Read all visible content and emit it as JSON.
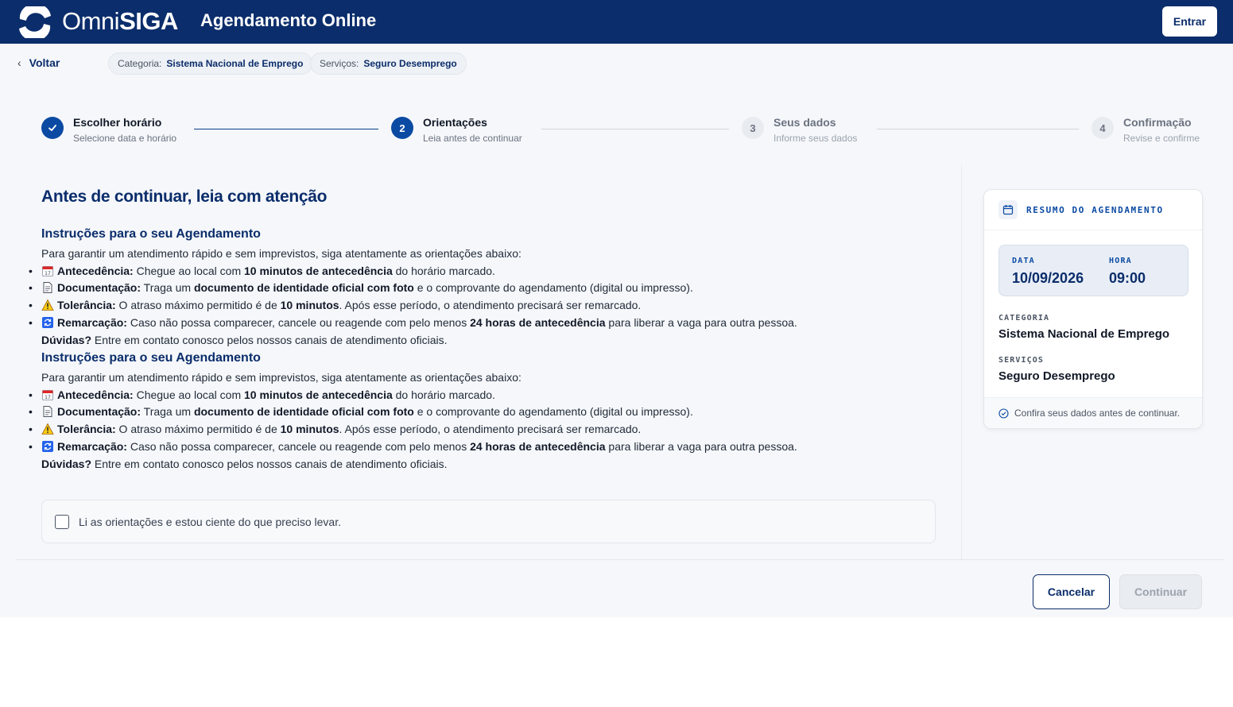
{
  "header": {
    "brand_omni": "Omni",
    "brand_siga": "SIGA",
    "app_title": "Agendamento Online",
    "login_label": "Entrar",
    "bg_color": "#0b2d6b"
  },
  "nav": {
    "back_label": "Voltar",
    "chips": [
      {
        "key": "Categoria:",
        "value": "Sistema Nacional de Emprego"
      },
      {
        "key": "Serviços:",
        "value": "Seguro Desemprego"
      }
    ]
  },
  "stepper": {
    "steps": [
      {
        "number": "1",
        "title": "Escolher horário",
        "subtitle": "Selecione data e horário",
        "state": "done"
      },
      {
        "number": "2",
        "title": "Orientações",
        "subtitle": "Leia antes de continuar",
        "state": "active"
      },
      {
        "number": "3",
        "title": "Seus dados",
        "subtitle": "Informe seus dados",
        "state": "todo"
      },
      {
        "number": "4",
        "title": "Confirmação",
        "subtitle": "Revise e confirme",
        "state": "todo"
      }
    ]
  },
  "content": {
    "title": "Antes de continuar, leia com atenção",
    "instructions": {
      "heading": "Instruções para o seu Agendamento",
      "intro": "Para garantir um atendimento rápido e sem imprevistos, siga atentamente as orientações abaixo:",
      "items": [
        {
          "icon": "calendar-icon",
          "label": "Antecedência:",
          "t1": " Chegue ao local com ",
          "b1": "10 minutos de antecedência",
          "t2": " do horário marcado.",
          "b2": "",
          "t3": ""
        },
        {
          "icon": "document-icon",
          "label": "Documentação:",
          "t1": " Traga um ",
          "b1": "documento de identidade oficial com foto",
          "t2": " e o comprovante do agendamento (digital ou impresso).",
          "b2": "",
          "t3": ""
        },
        {
          "icon": "warning-icon",
          "label": "Tolerância:",
          "t1": " O atraso máximo permitido é de ",
          "b1": "10 minutos",
          "t2": ". Após esse período, o atendimento precisará ser remarcado.",
          "b2": "",
          "t3": ""
        },
        {
          "icon": "reschedule-icon",
          "label": "Remarcação:",
          "t1": " Caso não possa comparecer, cancele ou reagende com pelo menos ",
          "b1": "24 horas de antecedência",
          "t2": " para liberar a vaga para outra pessoa.",
          "b2": "",
          "t3": ""
        }
      ],
      "footer_bold": "Dúvidas?",
      "footer_text": " Entre em contato conosco pelos nossos canais de atendimento oficiais."
    },
    "ack_label": "Li as orientações e estou ciente do que preciso levar."
  },
  "summary": {
    "title": "RESUMO DO AGENDAMENTO",
    "date_label": "DATA",
    "date_value": "10/09/2026",
    "time_label": "HORA",
    "time_value": "09:00",
    "category_label": "CATEGORIA",
    "category_value": "Sistema Nacional de Emprego",
    "services_label": "SERVIÇOS",
    "services_value": "Seguro Desemprego",
    "footer_note": "Confira seus dados antes de continuar."
  },
  "actions": {
    "cancel_label": "Cancelar",
    "continue_label": "Continuar"
  }
}
